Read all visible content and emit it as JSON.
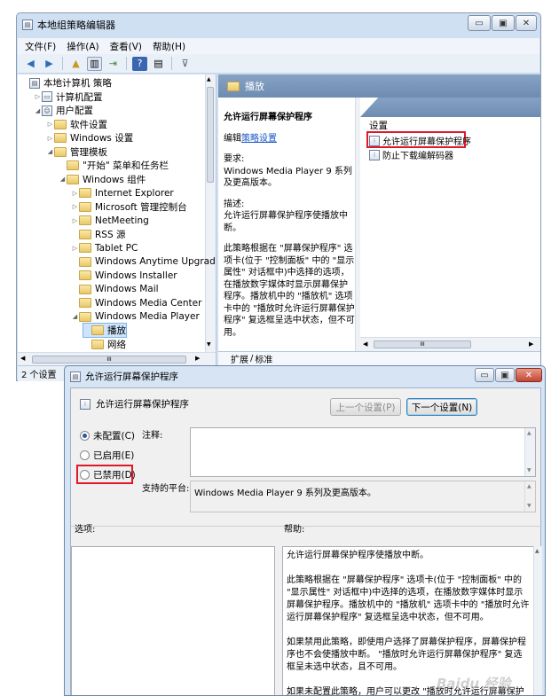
{
  "main_window": {
    "title": "本地组策略编辑器",
    "menu": [
      "文件(F)",
      "操作(A)",
      "查看(V)",
      "帮助(H)"
    ],
    "tree": [
      {
        "label": "本地计算机 策略",
        "depth": 0,
        "arrow": "",
        "icon": "policy"
      },
      {
        "label": "计算机配置",
        "depth": 1,
        "arrow": "▷",
        "icon": "computer"
      },
      {
        "label": "用户配置",
        "depth": 1,
        "arrow": "◢",
        "icon": "user"
      },
      {
        "label": "软件设置",
        "depth": 2,
        "arrow": "▷",
        "icon": "folder"
      },
      {
        "label": "Windows 设置",
        "depth": 2,
        "arrow": "▷",
        "icon": "folder"
      },
      {
        "label": "管理模板",
        "depth": 2,
        "arrow": "◢",
        "icon": "folder"
      },
      {
        "label": "\"开始\" 菜单和任务栏",
        "depth": 3,
        "arrow": "",
        "icon": "folder"
      },
      {
        "label": "Windows 组件",
        "depth": 3,
        "arrow": "◢",
        "icon": "folder"
      },
      {
        "label": "Internet Explorer",
        "depth": 4,
        "arrow": "▷",
        "icon": "folder"
      },
      {
        "label": "Microsoft 管理控制台",
        "depth": 4,
        "arrow": "▷",
        "icon": "folder"
      },
      {
        "label": "NetMeeting",
        "depth": 4,
        "arrow": "▷",
        "icon": "folder"
      },
      {
        "label": "RSS 源",
        "depth": 4,
        "arrow": "",
        "icon": "folder"
      },
      {
        "label": "Tablet PC",
        "depth": 4,
        "arrow": "▷",
        "icon": "folder"
      },
      {
        "label": "Windows Anytime Upgrade",
        "depth": 4,
        "arrow": "",
        "icon": "folder"
      },
      {
        "label": "Windows Installer",
        "depth": 4,
        "arrow": "",
        "icon": "folder"
      },
      {
        "label": "Windows Mail",
        "depth": 4,
        "arrow": "",
        "icon": "folder"
      },
      {
        "label": "Windows Media Center",
        "depth": 4,
        "arrow": "",
        "icon": "folder"
      },
      {
        "label": "Windows Media Player",
        "depth": 4,
        "arrow": "◢",
        "icon": "folder"
      },
      {
        "label": "播放",
        "depth": 5,
        "arrow": "",
        "icon": "folder",
        "selected": true
      },
      {
        "label": "网络",
        "depth": 5,
        "arrow": "",
        "icon": "folder"
      }
    ],
    "pane_header": "播放",
    "desc": {
      "title": "允许运行屏幕保护程序",
      "edit_prefix": "编辑",
      "edit_link": "策略设置",
      "req_label": "要求:",
      "req_text": "Windows Media Player 9 系列及更高版本。",
      "desc_label": "描述:",
      "desc_text": "允许运行屏幕保护程序使播放中断。",
      "detail": "此策略根据在 \"屏幕保护程序\" 选项卡(位于 \"控制面板\" 中的 \"显示属性\" 对话框中)中选择的选项，在播放数字媒体时显示屏幕保护程序。播放机中的 \"播放机\" 选项卡中的 \"播放时允许运行屏幕保护程序\" 复选框呈选中状态，但不可用。"
    },
    "settings_header": "设置",
    "settings": [
      "允许运行屏幕保护程序",
      "防止下载编解码器"
    ],
    "tabs": [
      "扩展",
      "标准"
    ],
    "hscroll_mark": "III",
    "status": "2 个设置"
  },
  "dialog": {
    "title": "允许运行屏幕保护程序",
    "heading": "允许运行屏幕保护程序",
    "prev_button": "上一个设置(P)",
    "next_button": "下一个设置(N)",
    "radios": [
      {
        "label": "未配置(C)",
        "checked": true
      },
      {
        "label": "已启用(E)",
        "checked": false
      },
      {
        "label": "已禁用(D)",
        "checked": false
      }
    ],
    "comment_label": "注释:",
    "supported_label": "支持的平台:",
    "supported_value": "Windows Media Player 9 系列及更高版本。",
    "options_label": "选项:",
    "help_label": "帮助:",
    "help_paragraphs": [
      "允许运行屏幕保护程序使播放中断。",
      "此策略根据在 \"屏幕保护程序\" 选项卡(位于 \"控制面板\" 中的 \"显示属性\" 对话框中)中选择的选项，在播放数字媒体时显示屏幕保护程序。播放机中的 \"播放机\" 选项卡中的 \"播放时允许运行屏幕保护程序\" 复选框呈选中状态，但不可用。",
      "如果禁用此策略，即使用户选择了屏幕保护程序，屏幕保护程序也不会使播放中断。 \"播放时允许运行屏幕保护程序\" 复选框呈未选中状态，且不可用。",
      "如果未配置此策略，用户可以更改 \"播放时允许运行屏幕保护程序\" 复选框的设置。"
    ]
  },
  "watermark": "Baidu 经验",
  "highlight_color": "#e0192a"
}
